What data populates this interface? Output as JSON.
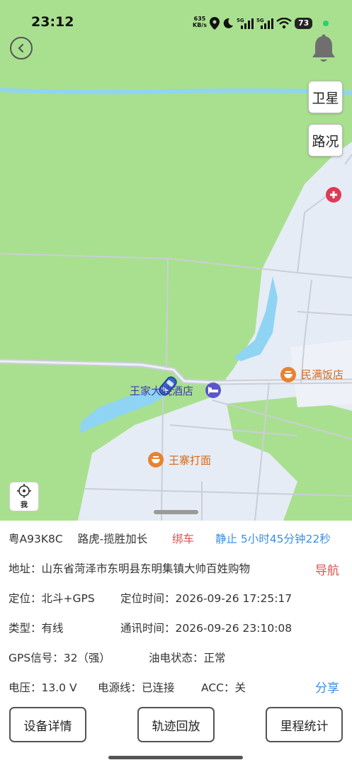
{
  "status_bar": {
    "time": "23:12",
    "net_rate_top": "635",
    "net_rate_bottom": "KB/s",
    "battery": "73"
  },
  "map": {
    "satellite_label": "卫星",
    "traffic_label": "路况",
    "locate_me_label": "我",
    "pois": {
      "hotel": "王家大院酒店",
      "restaurant1": "民满饭店",
      "restaurant2": "王寨打面"
    },
    "colors": {
      "land": "#a9e08f",
      "urban": "#e6ecf5",
      "water": "#8fd4f3",
      "road": "#c9ced8"
    }
  },
  "info": {
    "plate": "粤A93K8C",
    "model": "路虎-揽胜加长",
    "bind_label": "绑车",
    "status": "静止 5小时45分钟22秒",
    "address_label": "地址：",
    "address": "山东省菏泽市东明县东明集镇大帅百姓购物",
    "navigate_label": "导航",
    "positioning_label": "定位：",
    "positioning": "北斗+GPS",
    "position_time_label": "定位时间：",
    "position_time": "2026-09-26 17:25:17",
    "type_label": "类型：",
    "type": "有线",
    "comm_time_label": "通讯时间：",
    "comm_time": "2026-09-26 23:10:08",
    "gps_signal_label": "GPS信号：",
    "gps_signal": "32（强）",
    "oil_elec_label": "油电状态：",
    "oil_elec": "正常",
    "voltage_label": "电压：",
    "voltage": "13.0 V",
    "power_line_label": "电源线：",
    "power_line": "已连接",
    "acc_label": "ACC：",
    "acc": "关",
    "share_label": "分享"
  },
  "actions": {
    "device_detail": "设备详情",
    "track_playback": "轨迹回放",
    "mileage_stats": "里程统计"
  }
}
